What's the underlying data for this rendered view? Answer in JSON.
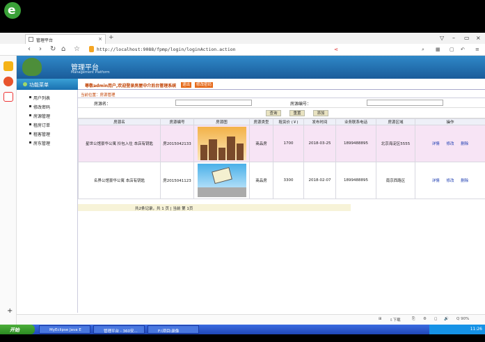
{
  "browser": {
    "tab_title": "管理平台",
    "tab_close": "×",
    "new_tab": "+",
    "url": "http://localhost:9088/fpmp/login/loginAction.action",
    "nav": [
      "‹",
      "›",
      "↻",
      "⌂",
      "☆"
    ],
    "window_controls": [
      "▽",
      "–",
      "▭",
      "×"
    ]
  },
  "header": {
    "title": "管理平台",
    "subtitle": "Management Platform"
  },
  "menu": {
    "heading": "功能菜单",
    "items": [
      "用户列表",
      "修改密码",
      "房源管理",
      "租房订单",
      "租客管理",
      "房东管理"
    ]
  },
  "welcome": {
    "text": "尊敬admin用户,欢迎登录房屋中介后台管理系统",
    "btn1": "退出",
    "btn2": "修改密码"
  },
  "breadcrumb": "当前位置：房源管理",
  "search": {
    "label_name": "房源名：",
    "label_id": "房源编号："
  },
  "buttons": {
    "query": "查询",
    "reset": "重置",
    "add": "添加"
  },
  "table": {
    "columns": [
      "房源名",
      "房源编号",
      "房源图",
      "房源类型",
      "租赁价 (￥)",
      "发布时间",
      "业务联系电话",
      "房源区域",
      "操作"
    ],
    "rows": [
      {
        "name": "星世公馆豪华公寓 拎包入住 本店有钥匙",
        "id": "房2015042133",
        "type": "商品房",
        "price": "1700",
        "date": "2018-03-25",
        "phone": "1899488895",
        "area": "北京海淀区5555"
      },
      {
        "name": "名界公馆豪华公寓 本店有钥匙",
        "id": "房2015041123",
        "type": "商品房",
        "price": "3300",
        "date": "2018-02-07",
        "phone": "1899488895",
        "area": "南京西路区"
      }
    ],
    "actions": [
      "详情",
      "修改",
      "删除"
    ]
  },
  "pager": "共2条记录，共 1 页 | 当前 第 1页",
  "statusbar": [
    "⊞",
    "⇩下载",
    "⎘",
    "⚙",
    "◻",
    "🔊",
    "Q 90%"
  ],
  "taskbar": {
    "start": "开始",
    "tasks": [
      "MyEclipse Java E",
      "管理平台 - 360安...",
      "F:\\项目\\录像"
    ],
    "clock": "11:26"
  }
}
